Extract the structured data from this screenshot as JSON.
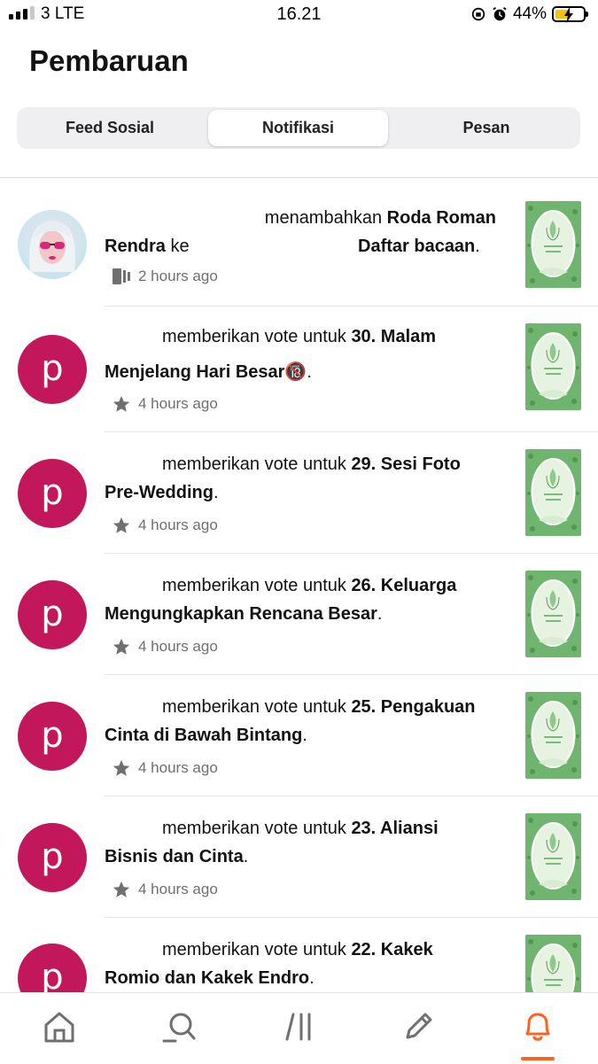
{
  "status_bar": {
    "carrier": "3  LTE",
    "time": "16.21",
    "battery": "44%"
  },
  "page_title": "Pembaruan",
  "tabs": [
    {
      "label": "Feed Sosial",
      "active": false
    },
    {
      "label": "Notifikasi",
      "active": true
    },
    {
      "label": "Pesan",
      "active": false
    }
  ],
  "notifications": [
    {
      "avatar": "photo",
      "line1_action": "menambahkan ",
      "line1_bold": "Roda Roman",
      "line2_user": "Rendra",
      "line2_mid": " ke",
      "line2_bold": "Daftar bacaan",
      "line2_end": ".",
      "meta_icon": "reading-list-icon",
      "time": "2 hours ago"
    },
    {
      "avatar": "p",
      "line1_action": "memberikan vote untuk ",
      "line1_bold": "30. Malam",
      "line2_bold": "Menjelang Hari Besar🔞",
      "line2_end": ".",
      "meta_icon": "star-icon",
      "time": "4 hours ago"
    },
    {
      "avatar": "p",
      "line1_action": "memberikan vote untuk ",
      "line1_bold": "29. Sesi Foto",
      "line2_bold": "Pre-Wedding",
      "line2_end": ".",
      "meta_icon": "star-icon",
      "time": "4 hours ago"
    },
    {
      "avatar": "p",
      "line1_action": "memberikan vote untuk ",
      "line1_bold": "26. Keluarga",
      "line2_bold": "Mengungkapkan Rencana Besar",
      "line2_end": ".",
      "meta_icon": "star-icon",
      "time": "4 hours ago"
    },
    {
      "avatar": "p",
      "line1_action": "memberikan vote untuk ",
      "line1_bold": "25. Pengakuan",
      "line2_bold": "Cinta di Bawah Bintang",
      "line2_end": ".",
      "meta_icon": "star-icon",
      "time": "4 hours ago"
    },
    {
      "avatar": "p",
      "line1_action": "memberikan vote untuk ",
      "line1_bold": "23. Aliansi",
      "line2_bold": "Bisnis dan Cinta",
      "line2_end": ".",
      "meta_icon": "star-icon",
      "time": "4 hours ago"
    },
    {
      "avatar": "p",
      "line1_action": "memberikan vote untuk ",
      "line1_bold": "22. Kakek",
      "line2_bold": "Romio dan Kakek Endro",
      "line2_end": ".",
      "meta_icon": "star-icon",
      "time": ""
    }
  ],
  "avatar_letter": "p",
  "colors": {
    "accent": "#ff6122",
    "avatar_bg": "#c2185b",
    "cover_green": "#6fb56f"
  },
  "bottom_nav": [
    {
      "name": "home-icon"
    },
    {
      "name": "search-icon"
    },
    {
      "name": "library-icon"
    },
    {
      "name": "write-icon"
    },
    {
      "name": "notifications-icon",
      "active": true
    }
  ]
}
